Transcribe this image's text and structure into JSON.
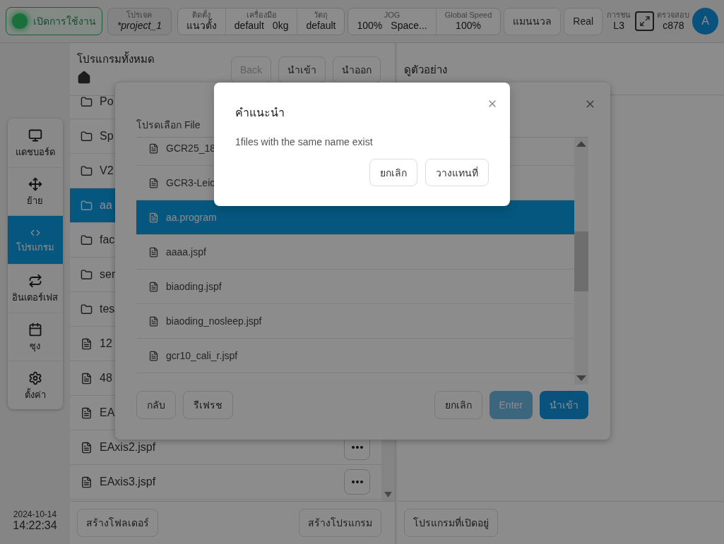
{
  "top_bar": {
    "start_button": {
      "label": "เปิดการใช้งาน",
      "on": true
    },
    "project": {
      "label": "โปรเจค",
      "value": "*project_1"
    },
    "install_group": [
      {
        "label": "ติดตั้ง",
        "values": [
          "แนวตั้ง"
        ]
      },
      {
        "label": "เครื่องมือ",
        "values": [
          "default",
          "0kg"
        ]
      },
      {
        "label": "วัตถุ",
        "values": [
          "default"
        ]
      }
    ],
    "speed_group": [
      {
        "label": "JOG",
        "values": [
          "100%",
          "Space..."
        ]
      },
      {
        "label": "Global Speed",
        "values": [
          "100%"
        ]
      }
    ],
    "mode_button": "แมนนวล",
    "real_button": "Real",
    "collision": {
      "label": "การชน",
      "value": "L3"
    },
    "check": {
      "label": "ตรวจสอบ",
      "value": "c878"
    },
    "avatar": "A"
  },
  "sidebar": {
    "items": [
      {
        "label": "แดชบอร์ด",
        "selected": false
      },
      {
        "label": "ย้าย",
        "selected": false
      },
      {
        "label": "โปรแกรม",
        "selected": true
      },
      {
        "label": "อินเตอร์เฟส",
        "selected": false
      },
      {
        "label": "ซุง",
        "selected": false
      },
      {
        "label": "ตั้งค่า",
        "selected": false
      }
    ],
    "date": "2024-10-14",
    "time": "14:22:34"
  },
  "programs": {
    "title": "โปรแกรมทั้งหมด",
    "buttons": [
      {
        "label": "Back",
        "disabled": true
      },
      {
        "label": "นำเข้า",
        "disabled": false
      },
      {
        "label": "นำออก",
        "disabled": false
      }
    ],
    "rows": [
      {
        "kind": "folder",
        "name": "Po",
        "selected": false,
        "menu": false
      },
      {
        "kind": "folder",
        "name": "Sp",
        "selected": false,
        "menu": false
      },
      {
        "kind": "folder",
        "name": "V2",
        "selected": false,
        "menu": false
      },
      {
        "kind": "folder",
        "name": "aa",
        "selected": true,
        "menu": false
      },
      {
        "kind": "folder",
        "name": "fac",
        "selected": false,
        "menu": false
      },
      {
        "kind": "folder",
        "name": "ser",
        "selected": false,
        "menu": false
      },
      {
        "kind": "folder",
        "name": "tes",
        "selected": false,
        "menu": false
      },
      {
        "kind": "file",
        "name": "12",
        "selected": false,
        "menu": false
      },
      {
        "kind": "file",
        "name": "48",
        "selected": false,
        "menu": false
      },
      {
        "kind": "file",
        "name": "EA",
        "selected": false,
        "menu": false
      },
      {
        "kind": "file",
        "name": "EAxis2.jspf",
        "selected": false,
        "menu": true
      },
      {
        "kind": "file",
        "name": "EAxis3.jspf",
        "selected": false,
        "menu": true
      }
    ],
    "footer_buttons": [
      "สร้างโฟลเดอร์",
      "สร้างโปรแกรม"
    ]
  },
  "preview": {
    "title": "ดูตัวอย่าง",
    "button": "โปรแกรมที่เปิดอยู่"
  },
  "file_dialog": {
    "title": "โปรดเลือก File",
    "rows": [
      {
        "name": "GCR25_18",
        "selected": false
      },
      {
        "name": "GCR3-Leic",
        "selected": false
      },
      {
        "name": "aa.program",
        "selected": true
      },
      {
        "name": "aaaa.jspf",
        "selected": false
      },
      {
        "name": "biaoding.jspf",
        "selected": false
      },
      {
        "name": "biaoding_nosleep.jspf",
        "selected": false
      },
      {
        "name": "gcr10_cali_r.jspf",
        "selected": false
      }
    ],
    "left_buttons": [
      "กลับ",
      "รีเฟรช"
    ],
    "right_buttons": [
      {
        "label": "ยกเลิก",
        "kind": "outline"
      },
      {
        "label": "Enter",
        "kind": "disabled"
      },
      {
        "label": "นำเข้า",
        "kind": "primary"
      }
    ]
  },
  "alert": {
    "title": "คำแนะนำ",
    "message": "1files with the same name exist",
    "buttons": [
      "ยกเลิก",
      "วางแทนที่"
    ]
  }
}
